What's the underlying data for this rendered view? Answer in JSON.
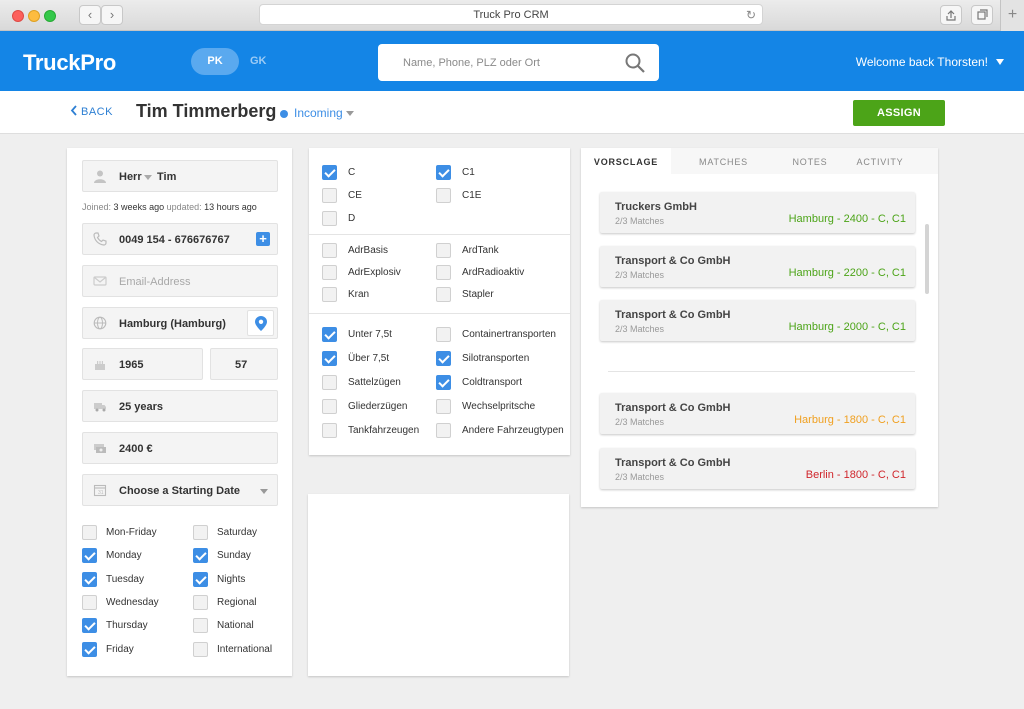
{
  "browser": {
    "title": "Truck Pro CRM",
    "back_glyph": "‹",
    "fwd_glyph": "›",
    "reload_glyph": "↻",
    "newtab_glyph": "+"
  },
  "header": {
    "logo": "TruckPro",
    "seg_pk": "PK",
    "seg_gk": "GK",
    "search_placeholder": "Name, Phone, PLZ oder Ort",
    "welcome": "Welcome back Thorsten!"
  },
  "subheader": {
    "back": "BACK",
    "name": "Tim Timmerberg",
    "status": "Incoming",
    "assign": "ASSIGN"
  },
  "profile": {
    "salutation": "Herr",
    "first_name": "Tim",
    "joined_label": "Joined:",
    "joined_value": "3 weeks ago",
    "updated_label": "updated:",
    "updated_value": "13 hours ago",
    "phone": "0049 154 - 676676767",
    "email_placeholder": "Email-Address",
    "location": "Hamburg (Hamburg)",
    "birth_year": "1965",
    "age": "57",
    "experience": "25 years",
    "salary": "2400 €",
    "start_date": "Choose a Starting Date",
    "days": [
      {
        "label": "Mon-Friday",
        "on": false
      },
      {
        "label": "Saturday",
        "on": false
      },
      {
        "label": "Monday",
        "on": true
      },
      {
        "label": "Sunday",
        "on": true
      },
      {
        "label": "Tuesday",
        "on": true
      },
      {
        "label": "Nights",
        "on": true
      },
      {
        "label": "Wednesday",
        "on": false
      },
      {
        "label": "Regional",
        "on": false
      },
      {
        "label": "Thursday",
        "on": true
      },
      {
        "label": "National",
        "on": false
      },
      {
        "label": "Friday",
        "on": true
      },
      {
        "label": "International",
        "on": false
      }
    ]
  },
  "licenses": {
    "classes": [
      {
        "label": "C",
        "on": true
      },
      {
        "label": "C1",
        "on": true
      },
      {
        "label": "CE",
        "on": false
      },
      {
        "label": "C1E",
        "on": false
      },
      {
        "label": "D",
        "on": false
      }
    ],
    "adr": [
      {
        "label": "AdrBasis",
        "on": false
      },
      {
        "label": "ArdTank",
        "on": false
      },
      {
        "label": "AdrExplosiv",
        "on": false
      },
      {
        "label": "ArdRadioaktiv",
        "on": false
      },
      {
        "label": "Kran",
        "on": false
      },
      {
        "label": "Stapler",
        "on": false
      }
    ],
    "vehicles": [
      {
        "label": "Unter 7,5t",
        "on": true
      },
      {
        "label": "Containertransporten",
        "on": false
      },
      {
        "label": "Über 7,5t",
        "on": true
      },
      {
        "label": "Silotransporten",
        "on": true
      },
      {
        "label": "Sattelzügen",
        "on": false
      },
      {
        "label": "Coldtransport",
        "on": true
      },
      {
        "label": "Gliederzügen",
        "on": false
      },
      {
        "label": "Wechselpritsche",
        "on": false
      },
      {
        "label": "Tankfahrzeugen",
        "on": false
      },
      {
        "label": "Andere Fahrzeugtypen",
        "on": false
      }
    ]
  },
  "tabs": [
    "VORSCLAGE",
    "MATCHES",
    "NOTES",
    "ACTIVITY"
  ],
  "matches": [
    {
      "company": "Truckers GmbH",
      "count": "2/3 Matches",
      "route": "Hamburg - 2400 - C, C1",
      "color": "#4ca418"
    },
    {
      "company": "Transport & Co GmbH",
      "count": "2/3 Matches",
      "route": "Hamburg - 2200 - C, C1",
      "color": "#4ca418"
    },
    {
      "company": "Transport & Co GmbH",
      "count": "2/3 Matches",
      "route": "Hamburg - 2000 - C, C1",
      "color": "#4ca418"
    },
    {
      "company": "Transport & Co GmbH",
      "count": "2/3 Matches",
      "route": "Harburg - 1800 - C, C1",
      "color": "#f0a020"
    },
    {
      "company": "Transport & Co GmbH",
      "count": "2/3 Matches",
      "route": "Berlin - 1800 - C, C1",
      "color": "#d0262c"
    }
  ],
  "colors": {
    "brand": "#1485e6",
    "accent": "#3d8ee5",
    "assign": "#4ca418"
  }
}
